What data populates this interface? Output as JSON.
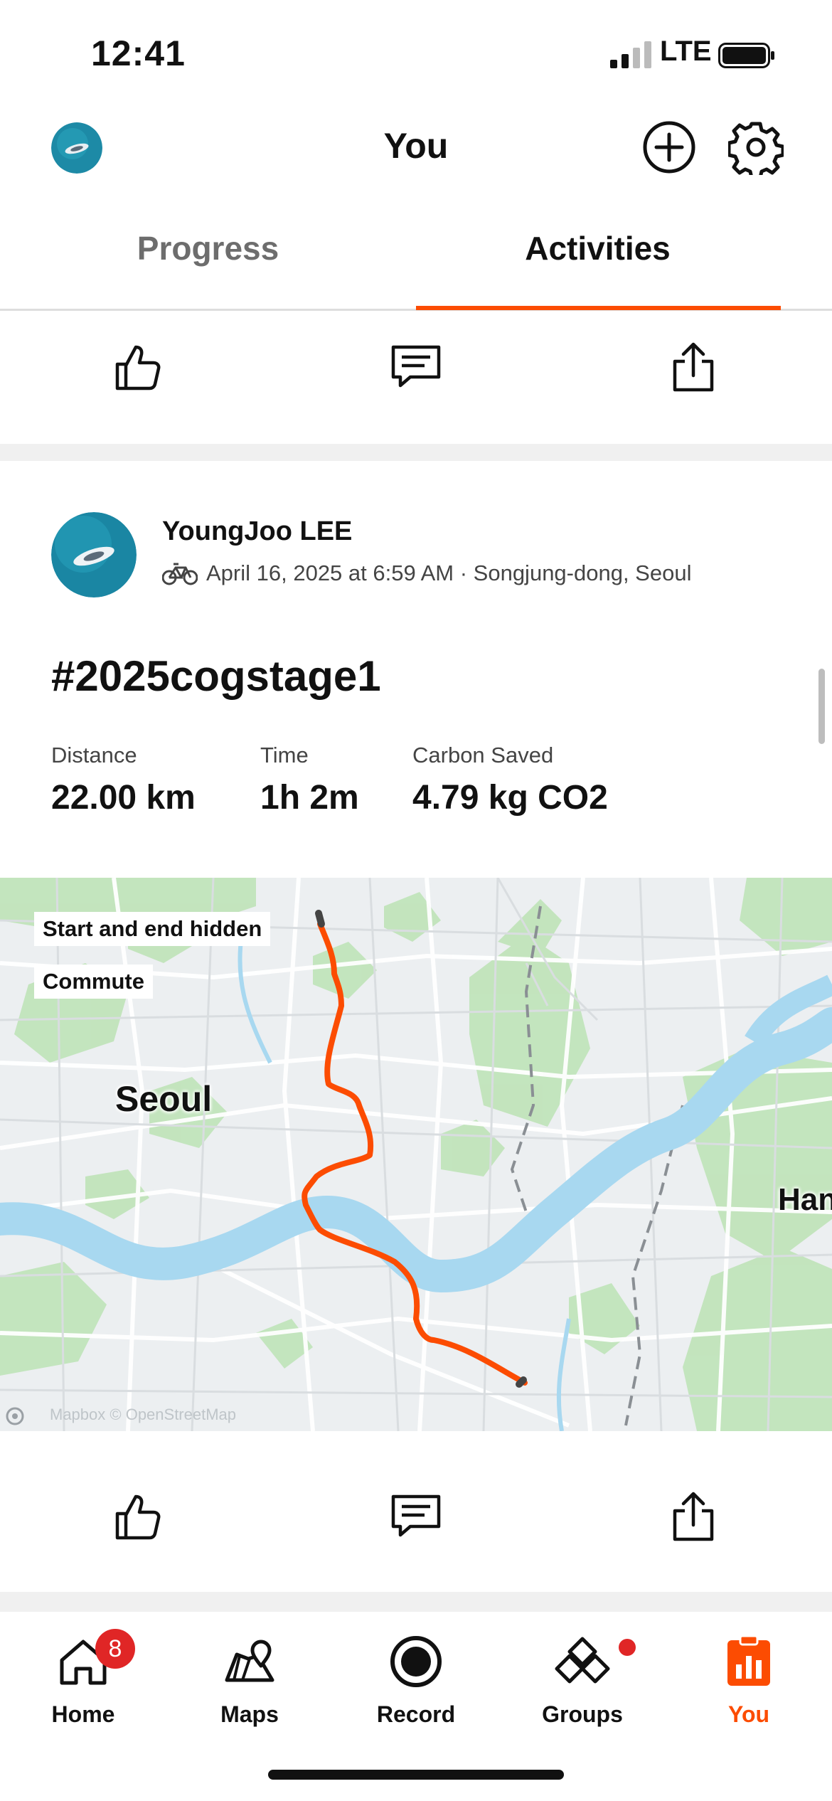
{
  "status_bar": {
    "time": "12:41",
    "network": "LTE"
  },
  "header": {
    "title": "You",
    "add_icon": "plus-circle-icon",
    "settings_icon": "gear-icon"
  },
  "tabs": [
    {
      "label": "Progress",
      "active": false
    },
    {
      "label": "Activities",
      "active": true
    }
  ],
  "action_row_icons": [
    "thumbs-up-icon",
    "comment-icon",
    "share-icon"
  ],
  "activity": {
    "athlete": "YoungJoo LEE",
    "sport_icon": "bicycle-icon",
    "date_location": "April 16, 2025 at 6:59 AM · Songjung-dong, Seoul",
    "title": "#2025cogstage1",
    "stats": [
      {
        "label": "Distance",
        "value": "22.00 km"
      },
      {
        "label": "Time",
        "value": "1h 2m"
      },
      {
        "label": "Carbon Saved",
        "value": "4.79 kg CO2"
      }
    ],
    "map": {
      "badges": [
        "Start and end hidden",
        "Commute"
      ],
      "city_label": "Seoul",
      "edge_label": "Han",
      "attribution": "Mapbox © OpenStreetMap",
      "route_color": "#fc4c02"
    }
  },
  "bottom_nav": [
    {
      "label": "Home",
      "icon": "home-icon",
      "badge": "8",
      "active": false
    },
    {
      "label": "Maps",
      "icon": "map-icon",
      "active": false
    },
    {
      "label": "Record",
      "icon": "record-icon",
      "active": false
    },
    {
      "label": "Groups",
      "icon": "groups-icon",
      "dot": true,
      "active": false
    },
    {
      "label": "You",
      "icon": "you-chart-icon",
      "active": true
    }
  ],
  "colors": {
    "accent": "#fc4c02",
    "badge": "#e02626",
    "water": "#a8d8f0",
    "park": "#bfe3b8"
  }
}
